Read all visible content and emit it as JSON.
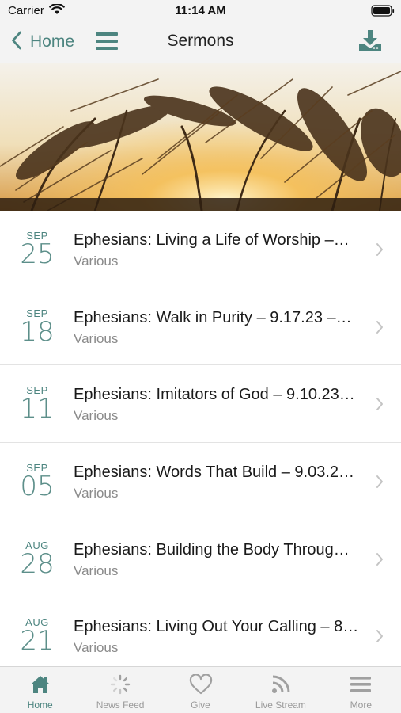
{
  "status_bar": {
    "carrier": "Carrier",
    "time": "11:14 AM",
    "icons": [
      "wifi-icon",
      "battery-icon"
    ]
  },
  "nav": {
    "back_label": "Home",
    "title": "Sermons",
    "icons": [
      "chevron-left-icon",
      "hamburger-menu-icon",
      "download-icon"
    ]
  },
  "colors": {
    "accent": "#4d8580",
    "bar_background": "#f3f3f3",
    "secondary_text": "#8a8a8a"
  },
  "sermons": [
    {
      "month": "SEP",
      "day": "25",
      "title": "Ephesians: Living a Life of Worship –…",
      "speaker": "Various"
    },
    {
      "month": "SEP",
      "day": "18",
      "title": "Ephesians: Walk in Purity – 9.17.23 –…",
      "speaker": "Various"
    },
    {
      "month": "SEP",
      "day": "11",
      "title": "Ephesians: Imitators of God – 9.10.23…",
      "speaker": "Various"
    },
    {
      "month": "SEP",
      "day": "05",
      "title": "Ephesians: Words That Build – 9.03.2…",
      "speaker": "Various"
    },
    {
      "month": "AUG",
      "day": "28",
      "title": "Ephesians: Building the Body Throug…",
      "speaker": "Various"
    },
    {
      "month": "AUG",
      "day": "21",
      "title": "Ephesians: Living Out Your Calling – 8…",
      "speaker": "Various"
    }
  ],
  "tabs": [
    {
      "label": "Home",
      "icon": "home-icon",
      "active": true
    },
    {
      "label": "News Feed",
      "icon": "news-feed-icon",
      "active": false
    },
    {
      "label": "Give",
      "icon": "heart-icon",
      "active": false
    },
    {
      "label": "Live Stream",
      "icon": "live-stream-icon",
      "active": false
    },
    {
      "label": "More",
      "icon": "more-menu-icon",
      "active": false
    }
  ]
}
